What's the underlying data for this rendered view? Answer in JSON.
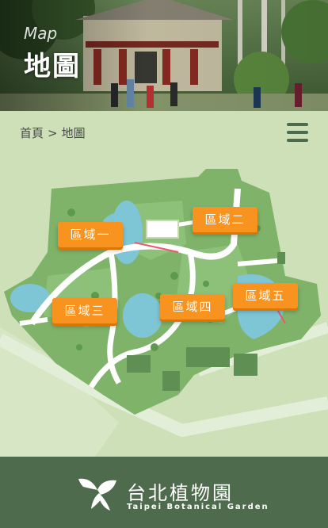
{
  "hero": {
    "subtitle": "Map",
    "title": "地圖"
  },
  "breadcrumb": {
    "home": "首頁",
    "separator": ">",
    "current": "地圖"
  },
  "menu": {
    "icon": "hamburger-menu-icon"
  },
  "map": {
    "areas": [
      {
        "label": "區域一"
      },
      {
        "label": "區域二"
      },
      {
        "label": "區域三"
      },
      {
        "label": "區域四"
      },
      {
        "label": "區域五"
      }
    ]
  },
  "footer": {
    "logo_cn": "台北植物園",
    "logo_en": "Taipei Botanical Garden",
    "logo_icon": "leaf-bird-logo-icon"
  },
  "colors": {
    "accent": "#f7931e",
    "footer_bg": "#4f6b4d",
    "map_bg": "#cde0b8",
    "park_green": "#7fb36a",
    "water": "#7ec6d6"
  }
}
